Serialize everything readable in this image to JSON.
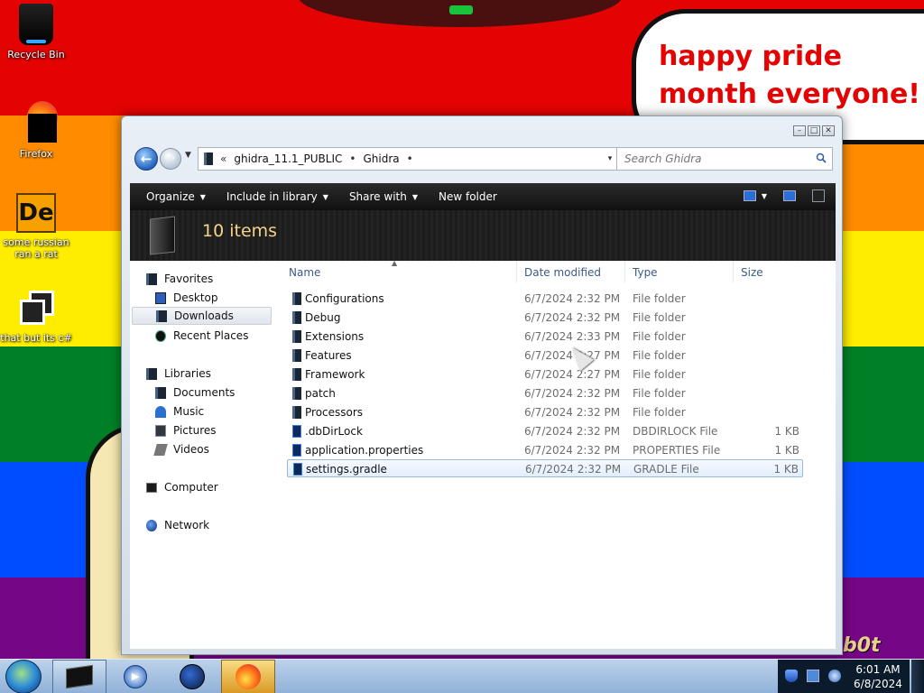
{
  "desktop": {
    "icons": [
      {
        "label": "Recycle Bin",
        "icon": "recycle-bin-icon"
      },
      {
        "label": "Firefox",
        "icon": "firefox-icon"
      },
      {
        "label": "some russian ran a rat",
        "icon": "de-app-icon",
        "glyph": "De"
      },
      {
        "label": "that but its c#",
        "icon": "windows-stack-icon"
      }
    ],
    "bubble_text": "happy pride month everyone!",
    "scribble": "b0t"
  },
  "window": {
    "controls": {
      "minimize": "–",
      "maximize": "□",
      "close": "✕"
    },
    "address": {
      "overflow": "«",
      "crumbs": [
        "ghidra_11.1_PUBLIC",
        "Ghidra"
      ],
      "dropdown": "▾",
      "refresh": "⇆"
    },
    "search": {
      "placeholder": "Search Ghidra"
    },
    "commands": {
      "organize": "Organize",
      "include": "Include in library",
      "share": "Share with",
      "new_folder": "New folder"
    },
    "header": {
      "count": "10 items"
    },
    "nav": {
      "favorites": "Favorites",
      "desktop": "Desktop",
      "downloads": "Downloads",
      "recent": "Recent Places",
      "libraries": "Libraries",
      "documents": "Documents",
      "music": "Music",
      "pictures": "Pictures",
      "videos": "Videos",
      "computer": "Computer",
      "network": "Network"
    },
    "columns": {
      "name": "Name",
      "date": "Date modified",
      "type": "Type",
      "size": "Size"
    },
    "files": [
      {
        "name": "Configurations",
        "date": "6/7/2024 2:32 PM",
        "type": "File folder",
        "size": "",
        "kind": "folder"
      },
      {
        "name": "Debug",
        "date": "6/7/2024 2:32 PM",
        "type": "File folder",
        "size": "",
        "kind": "folder"
      },
      {
        "name": "Extensions",
        "date": "6/7/2024 2:33 PM",
        "type": "File folder",
        "size": "",
        "kind": "folder"
      },
      {
        "name": "Features",
        "date": "6/7/2024 2:27 PM",
        "type": "File folder",
        "size": "",
        "kind": "folder"
      },
      {
        "name": "Framework",
        "date": "6/7/2024 2:27 PM",
        "type": "File folder",
        "size": "",
        "kind": "folder"
      },
      {
        "name": "patch",
        "date": "6/7/2024 2:32 PM",
        "type": "File folder",
        "size": "",
        "kind": "folder"
      },
      {
        "name": "Processors",
        "date": "6/7/2024 2:32 PM",
        "type": "File folder",
        "size": "",
        "kind": "folder"
      },
      {
        "name": ".dbDirLock",
        "date": "6/7/2024 2:32 PM",
        "type": "DBDIRLOCK File",
        "size": "1 KB",
        "kind": "file"
      },
      {
        "name": "application.properties",
        "date": "6/7/2024 2:32 PM",
        "type": "PROPERTIES File",
        "size": "1 KB",
        "kind": "file"
      },
      {
        "name": "settings.gradle",
        "date": "6/7/2024 2:32 PM",
        "type": "GRADLE File",
        "size": "1 KB",
        "kind": "file"
      }
    ],
    "selected_file": "settings.gradle"
  },
  "taskbar": {
    "clock_time": "6:01 AM",
    "clock_date": "6/8/2024",
    "media_glyph": "▶"
  }
}
